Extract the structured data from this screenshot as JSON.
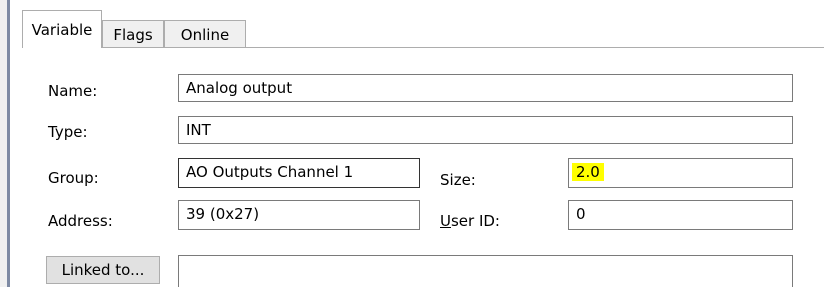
{
  "tabs": [
    {
      "label": "Variable"
    },
    {
      "label": "Flags"
    },
    {
      "label": "Online"
    }
  ],
  "form": {
    "name_label": "Name:",
    "name_value": "Analog output",
    "type_label": "Type:",
    "type_value": "INT",
    "group_label": "Group:",
    "group_value": "AO Outputs Channel 1",
    "size_label": "Size:",
    "size_value": "2.0",
    "address_label": "Address:",
    "address_value": "39 (0x27)",
    "userid_label_first": "U",
    "userid_label_rest": "ser ID:",
    "userid_value": "0",
    "linked_button": "Linked to...",
    "linked_value": ""
  },
  "colors": {
    "highlight": "#ffff00",
    "window_border": "#7e8aa3"
  }
}
